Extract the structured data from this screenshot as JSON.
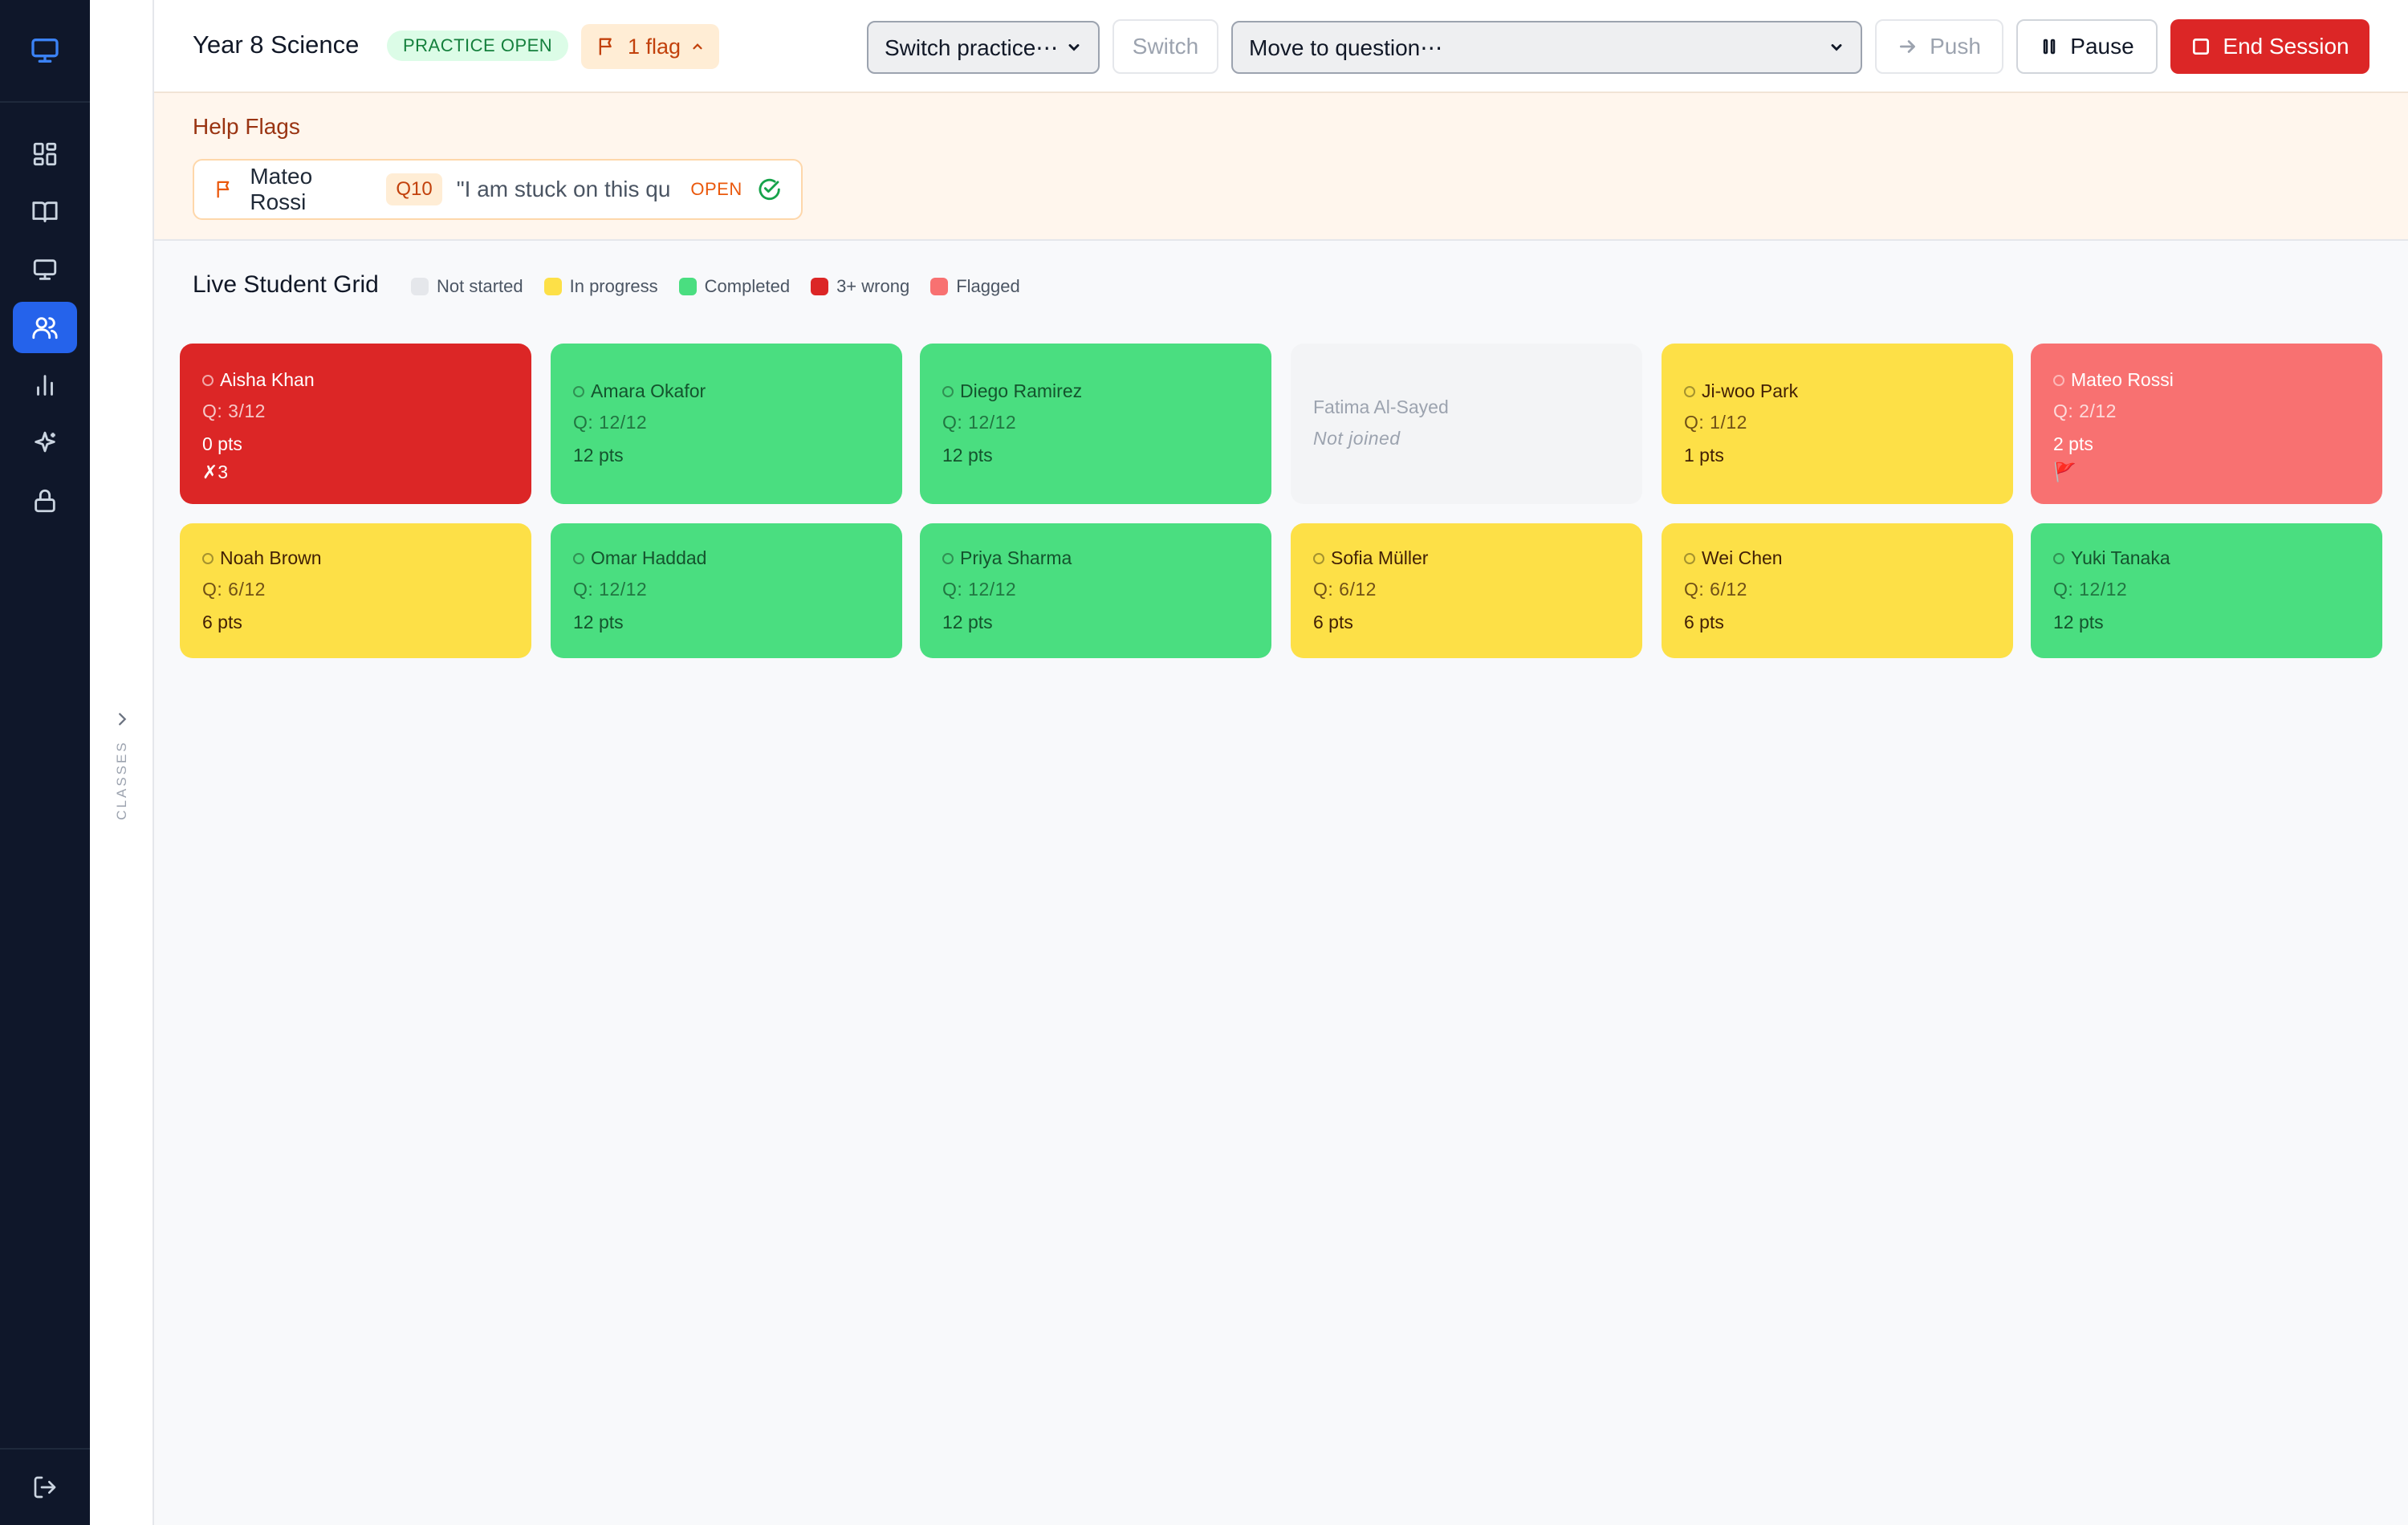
{
  "rail": {
    "icons": [
      "monitor-logo-icon",
      "dashboard-icon",
      "book-icon",
      "monitor-icon",
      "users-icon",
      "bar-chart-icon",
      "sparkles-icon",
      "lock-icon",
      "logout-icon"
    ],
    "active": "users-icon",
    "accent": "#2563eb"
  },
  "classes_panel": {
    "label": "CLASSES"
  },
  "header": {
    "title": "Year 8 Science",
    "status_badge": "PRACTICE OPEN",
    "flag_count": "1 flag",
    "switch_practice_placeholder": "Switch practice⋯",
    "switch_label": "Switch",
    "move_question_placeholder": "Move to question⋯",
    "push_label": "Push",
    "pause_label": "Pause",
    "end_label": "End Session"
  },
  "help_flags": {
    "title": "Help Flags",
    "items": [
      {
        "student": "Mateo Rossi",
        "question": "Q10",
        "message": "\"I am stuck on this question about the water cycle\"",
        "status": "OPEN"
      }
    ]
  },
  "grid": {
    "title": "Live Student Grid",
    "legend": [
      {
        "label": "Not started",
        "color": "#e5e7eb"
      },
      {
        "label": "In progress",
        "color": "#fde047"
      },
      {
        "label": "Completed",
        "color": "#4ade80"
      },
      {
        "label": "3+ wrong",
        "color": "#dc2626"
      },
      {
        "label": "Flagged",
        "color": "#f87171"
      }
    ],
    "students": [
      {
        "name": "Aisha Khan",
        "progress": "Q: 3/12",
        "points": "0 pts",
        "extra": "✗3",
        "state": "3+ wrong"
      },
      {
        "name": "Amara Okafor",
        "progress": "Q: 12/12",
        "points": "12 pts",
        "state": "Completed"
      },
      {
        "name": "Diego Ramirez",
        "progress": "Q: 12/12",
        "points": "12 pts",
        "state": "Completed"
      },
      {
        "name": "Fatima Al-Sayed",
        "progress": "Not joined",
        "state": "Not started"
      },
      {
        "name": "Ji-woo Park",
        "progress": "Q: 1/12",
        "points": "1 pts",
        "state": "In progress"
      },
      {
        "name": "Mateo Rossi",
        "progress": "Q: 2/12",
        "points": "2 pts",
        "extra": "🚩",
        "state": "Flagged"
      },
      {
        "name": "Noah Brown",
        "progress": "Q: 6/12",
        "points": "6 pts",
        "state": "In progress"
      },
      {
        "name": "Omar Haddad",
        "progress": "Q: 12/12",
        "points": "12 pts",
        "state": "Completed"
      },
      {
        "name": "Priya Sharma",
        "progress": "Q: 12/12",
        "points": "12 pts",
        "state": "Completed"
      },
      {
        "name": "Sofia Müller",
        "progress": "Q: 6/12",
        "points": "6 pts",
        "state": "In progress"
      },
      {
        "name": "Wei Chen",
        "progress": "Q: 6/12",
        "points": "6 pts",
        "state": "In progress"
      },
      {
        "name": "Yuki Tanaka",
        "progress": "Q: 12/12",
        "points": "12 pts",
        "state": "Completed"
      }
    ]
  }
}
